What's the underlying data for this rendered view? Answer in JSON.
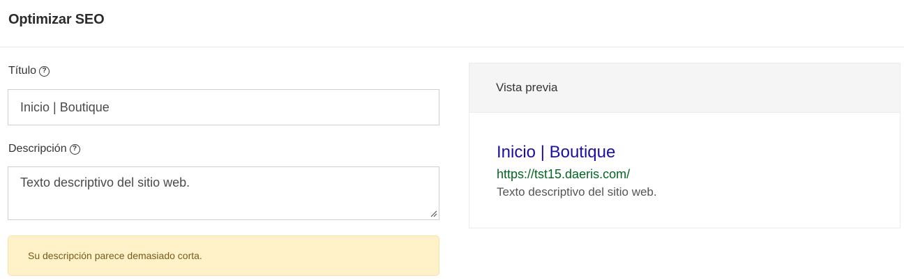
{
  "header": {
    "title": "Optimizar SEO"
  },
  "form": {
    "title_label": "Título",
    "title_value": "Inicio | Boutique",
    "description_label": "Descripción",
    "description_value": "Texto descriptivo del sitio web.",
    "help_icon_glyph": "?",
    "warning": "Su descripción parece demasiado corta."
  },
  "preview": {
    "heading": "Vista previa",
    "title": "Inicio | Boutique",
    "url": "https://tst15.daeris.com/",
    "description": "Texto descriptivo del sitio web."
  },
  "colors": {
    "serp_title": "#1a0dab",
    "serp_url": "#006621",
    "warning_bg": "#fff2c8"
  }
}
